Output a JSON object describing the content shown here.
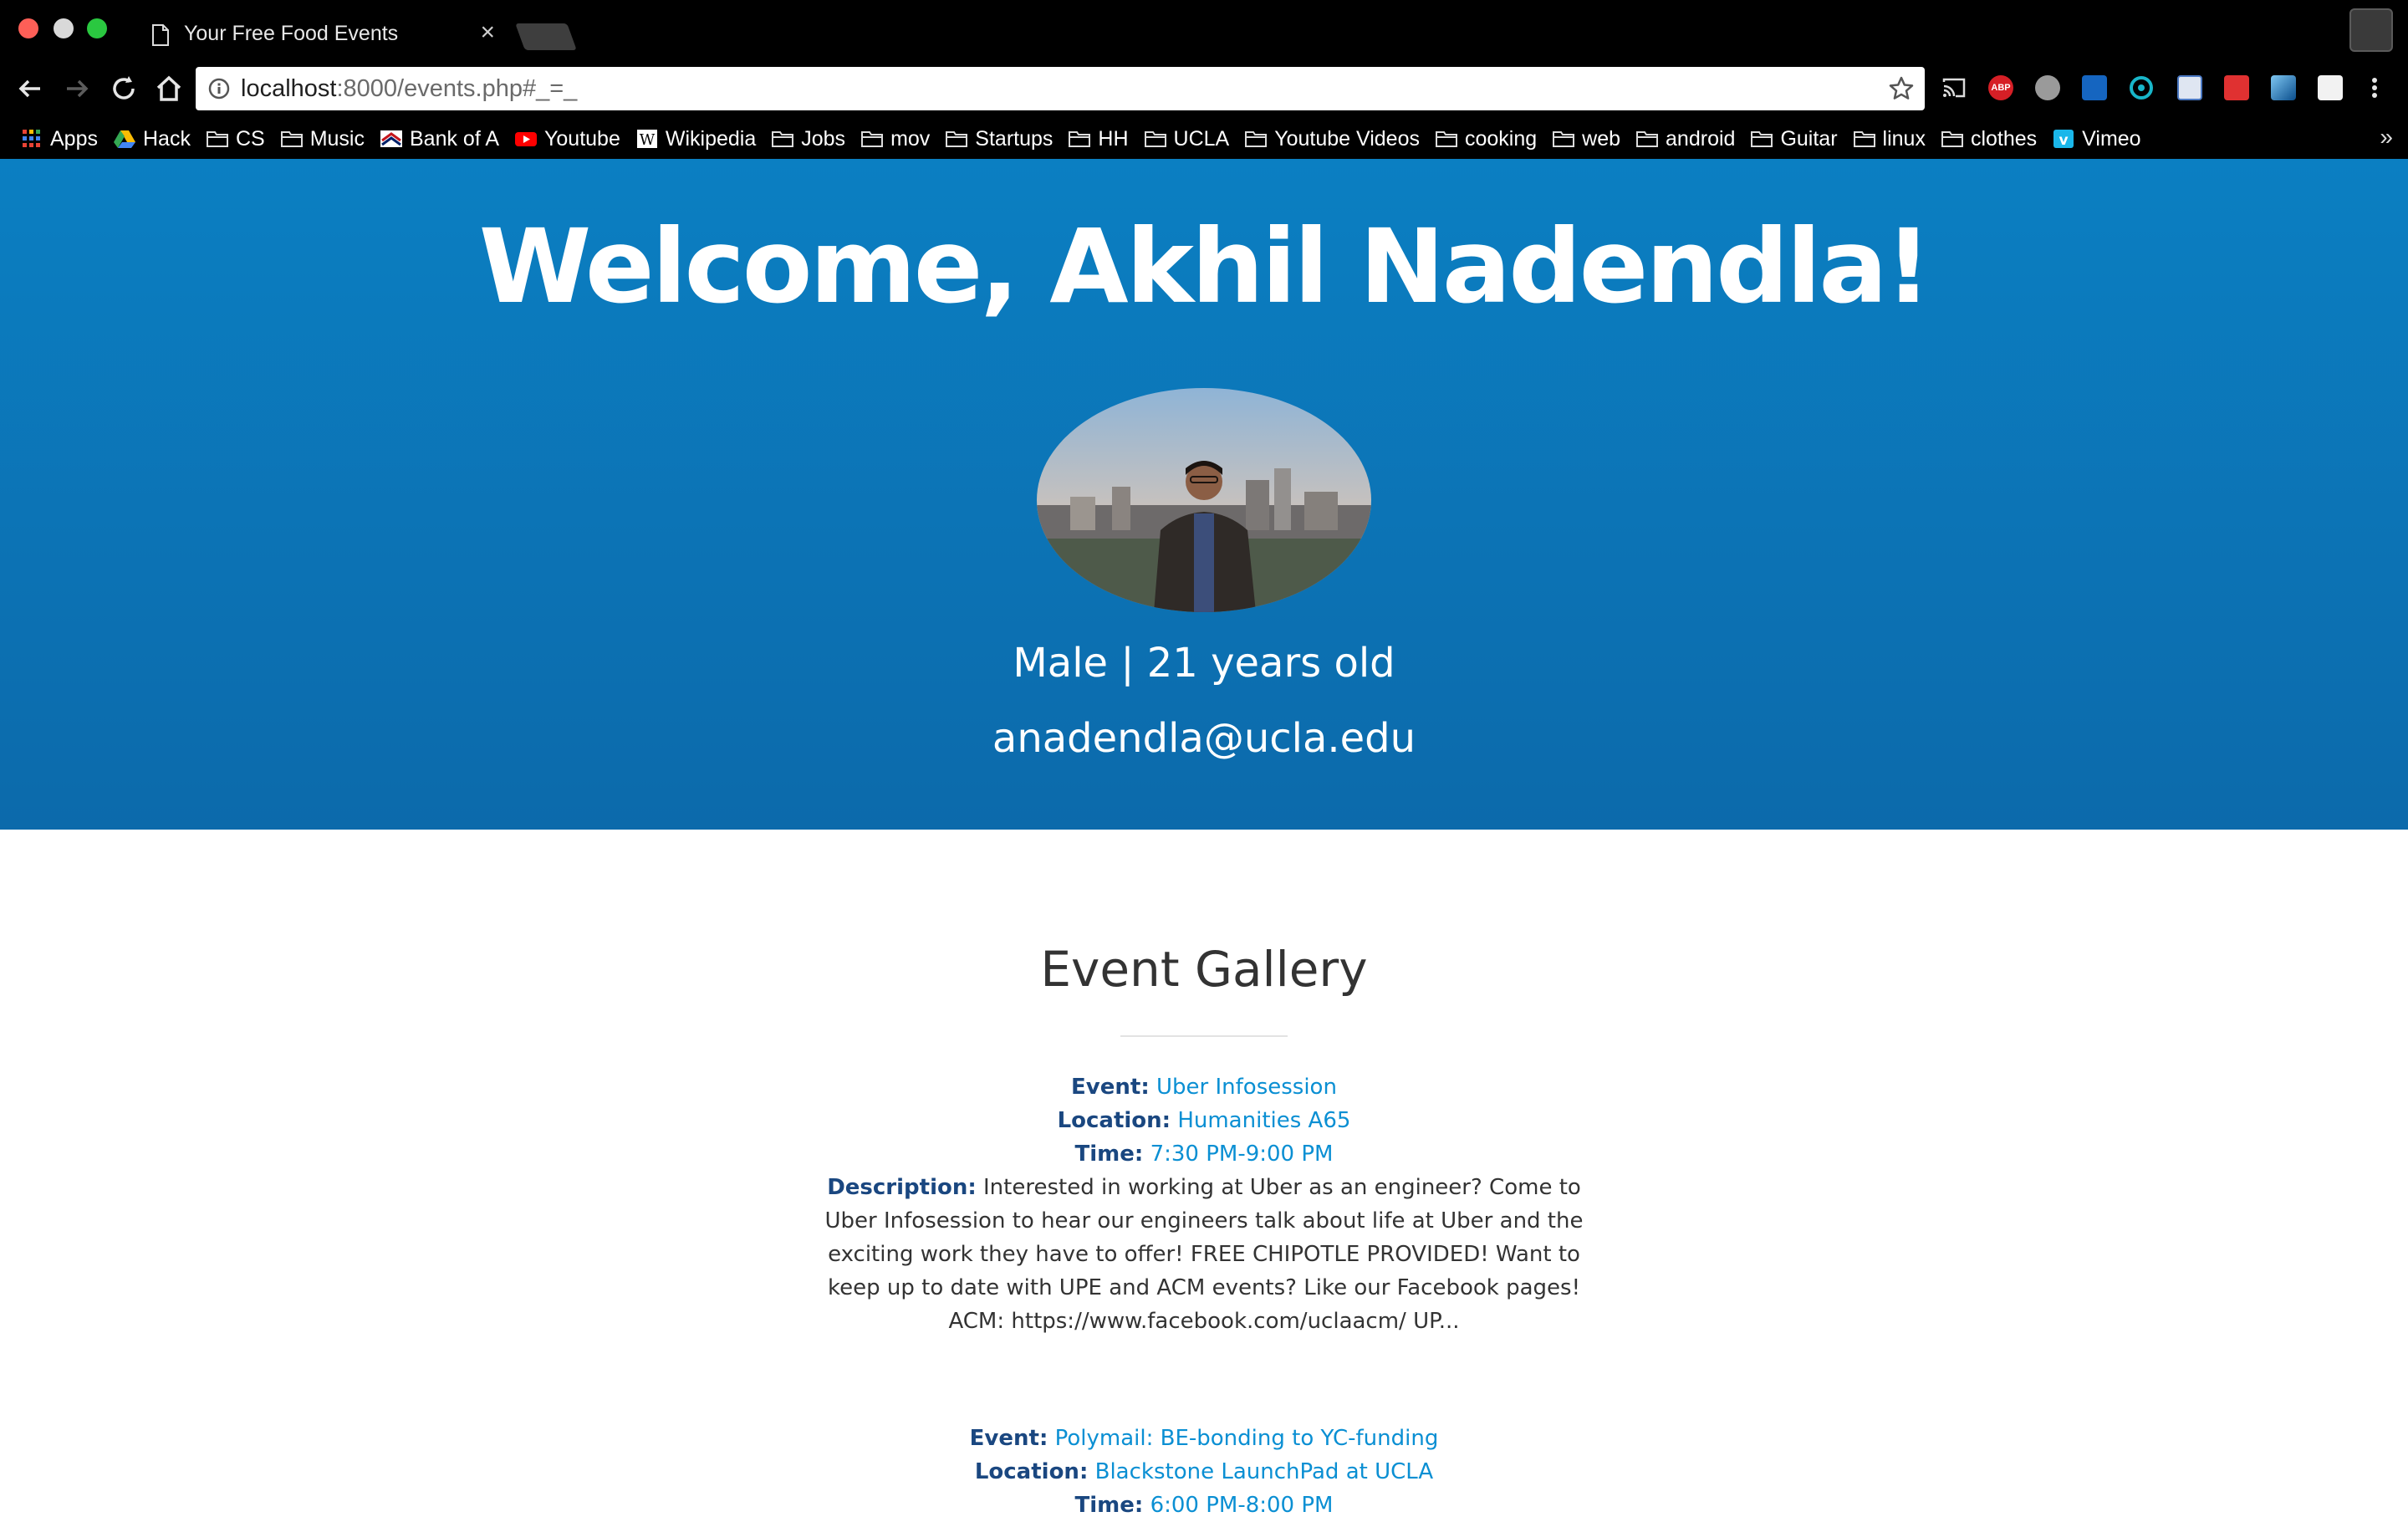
{
  "browser": {
    "tab_title": "Your Free Food Events",
    "tab_close": "×",
    "url_host": "localhost",
    "url_path": ":8000/events.php#_=_",
    "bookmarks": [
      {
        "label": "Apps",
        "icon": "apps-grid-icon"
      },
      {
        "label": "Hack",
        "icon": "google-drive-icon"
      },
      {
        "label": "CS",
        "icon": "folder-icon"
      },
      {
        "label": "Music",
        "icon": "folder-icon"
      },
      {
        "label": "Bank of A",
        "icon": "bank-of-america-icon"
      },
      {
        "label": "Youtube",
        "icon": "youtube-icon"
      },
      {
        "label": "Wikipedia",
        "icon": "wikipedia-icon"
      },
      {
        "label": "Jobs",
        "icon": "folder-icon"
      },
      {
        "label": "mov",
        "icon": "folder-icon"
      },
      {
        "label": "Startups",
        "icon": "folder-icon"
      },
      {
        "label": "HH",
        "icon": "folder-icon"
      },
      {
        "label": "UCLA",
        "icon": "folder-icon"
      },
      {
        "label": "Youtube Videos",
        "icon": "folder-icon"
      },
      {
        "label": "cooking",
        "icon": "folder-icon"
      },
      {
        "label": "web",
        "icon": "folder-icon"
      },
      {
        "label": "android",
        "icon": "folder-icon"
      },
      {
        "label": "Guitar",
        "icon": "folder-icon"
      },
      {
        "label": "linux",
        "icon": "folder-icon"
      },
      {
        "label": "clothes",
        "icon": "folder-icon"
      },
      {
        "label": "Vimeo",
        "icon": "vimeo-icon"
      }
    ],
    "bookmarks_more": "»"
  },
  "hero": {
    "welcome": "Welcome, Akhil Nadendla!",
    "gender_age": "Male | 21 years old",
    "email": "anadendla@ucla.edu"
  },
  "gallery": {
    "title": "Event Gallery",
    "labels": {
      "event": "Event:",
      "location": "Location:",
      "time": "Time:",
      "description": "Description:"
    },
    "events": [
      {
        "name": "Uber Infosession",
        "location": "Humanities A65",
        "time": "7:30 PM-9:00 PM",
        "description": "Interested in working at Uber as an engineer? Come to Uber Infosession to hear our engineers talk about life at Uber and the exciting work they have to offer! FREE CHIPOTLE PROVIDED! Want to keep up to date with UPE and ACM events? Like our Facebook pages! ACM: https://www.facebook.com/uclaacm/ UP..."
      },
      {
        "name": "Polymail: BE-bonding to YC-funding",
        "location": "Blackstone LaunchPad at UCLA",
        "time": "6:00 PM-8:00 PM"
      }
    ]
  },
  "colors": {
    "hero_top": "#0b7fc2",
    "hero_bottom": "#0c6aab",
    "label": "#1a4780",
    "link": "#0a8fd3"
  }
}
